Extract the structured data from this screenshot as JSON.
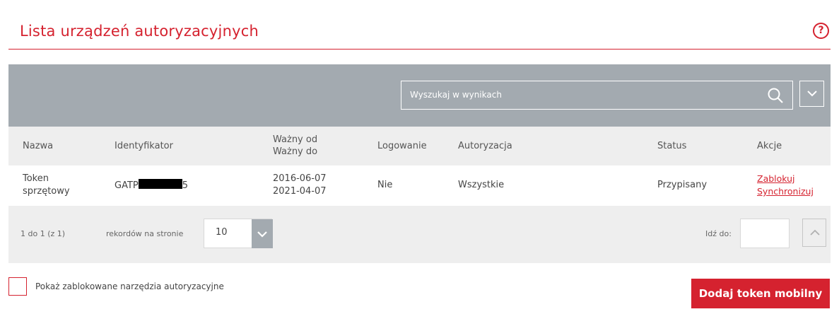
{
  "page": {
    "title": "Lista urządzeń autoryzacyjnych",
    "help_icon": "help-circle-icon",
    "help_glyph": "?"
  },
  "toolbar": {
    "search_placeholder": "Wyszukaj w wynikach",
    "search_icon": "search-icon",
    "expand_icon": "chevron-down-icon"
  },
  "table": {
    "columns": {
      "name": "Nazwa",
      "identifier": "Identyfikator",
      "valid_from": "Ważny od",
      "valid_to": "Ważny do",
      "login": "Logowanie",
      "authorization": "Autoryzacja",
      "status": "Status",
      "actions": "Akcje"
    },
    "rows": [
      {
        "name_line1": "Token",
        "name_line2": "sprzętowy",
        "identifier_prefix": "GATP",
        "identifier_suffix": "5",
        "valid_from": "2016-06-07",
        "valid_to": "2021-04-07",
        "login": "Nie",
        "authorization": "Wszystkie",
        "status": "Przypisany",
        "action_block": "Zablokuj",
        "action_sync": "Synchronizuj"
      }
    ]
  },
  "pager": {
    "range": "1 do 1 (z 1)",
    "per_page_label": "rekordów na stronie",
    "per_page_value": "10",
    "goto_label": "Idź do:",
    "goto_value": "",
    "up_icon": "chevron-up-icon"
  },
  "footer": {
    "show_blocked_label": "Pokaż zablokowane narzędzia autoryzacyjne",
    "show_blocked_checked": false,
    "add_button": "Dodaj token mobilny"
  },
  "colors": {
    "accent": "#d5222f",
    "toolbar": "#a3aab0",
    "panel": "#eeeeee"
  }
}
